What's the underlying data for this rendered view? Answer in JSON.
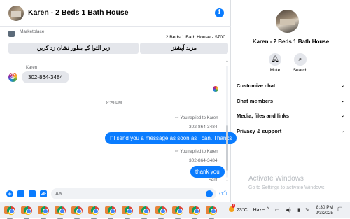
{
  "chat": {
    "title": "Karen - 2 Beds 1 Bath House",
    "marketplace": {
      "label": "Marketplace",
      "listing": "2 Beds 1 Bath House - $700",
      "btn_mark": "زیر التوا کے بطور نشان زد کریں",
      "btn_more": "مزید آپشنز"
    },
    "incoming": {
      "sender": "Karen",
      "text": "302-864-3484"
    },
    "timestamp": "8:29 PM",
    "outgoing": [
      {
        "replied": "You replied to Karen",
        "quoted": "302-864-3484",
        "text": "I'll send you a message as soon as I can. Thanks"
      },
      {
        "replied": "You replied to Karen",
        "quoted": "302-864-3484",
        "text": "thank you"
      }
    ],
    "status": "Sent",
    "composer_placeholder": "Aa"
  },
  "side": {
    "name": "Karen - 2 Beds 1 Bath House",
    "actions": {
      "mute": "Mute",
      "search": "Search"
    },
    "menu": [
      {
        "label": "Customize chat"
      },
      {
        "label": "Chat members"
      },
      {
        "label": "Media, files and links"
      },
      {
        "label": "Privacy & support"
      }
    ]
  },
  "watermark": {
    "title": "Activate Windows",
    "subtitle": "Go to Settings to activate Windows."
  },
  "taskbar": {
    "weather": {
      "temp": "23°C",
      "condition": "Haze",
      "badge": "1"
    },
    "time": "8:30 PM",
    "date": "2/3/2025"
  },
  "icons": {
    "info": "info-icon",
    "mute": "bell-icon",
    "search": "search-icon",
    "chevron": "chevron-down-icon",
    "like": "thumbs-up-icon"
  },
  "colors": {
    "accent": "#0a7cff",
    "bubble_in": "#e4e6eb"
  }
}
